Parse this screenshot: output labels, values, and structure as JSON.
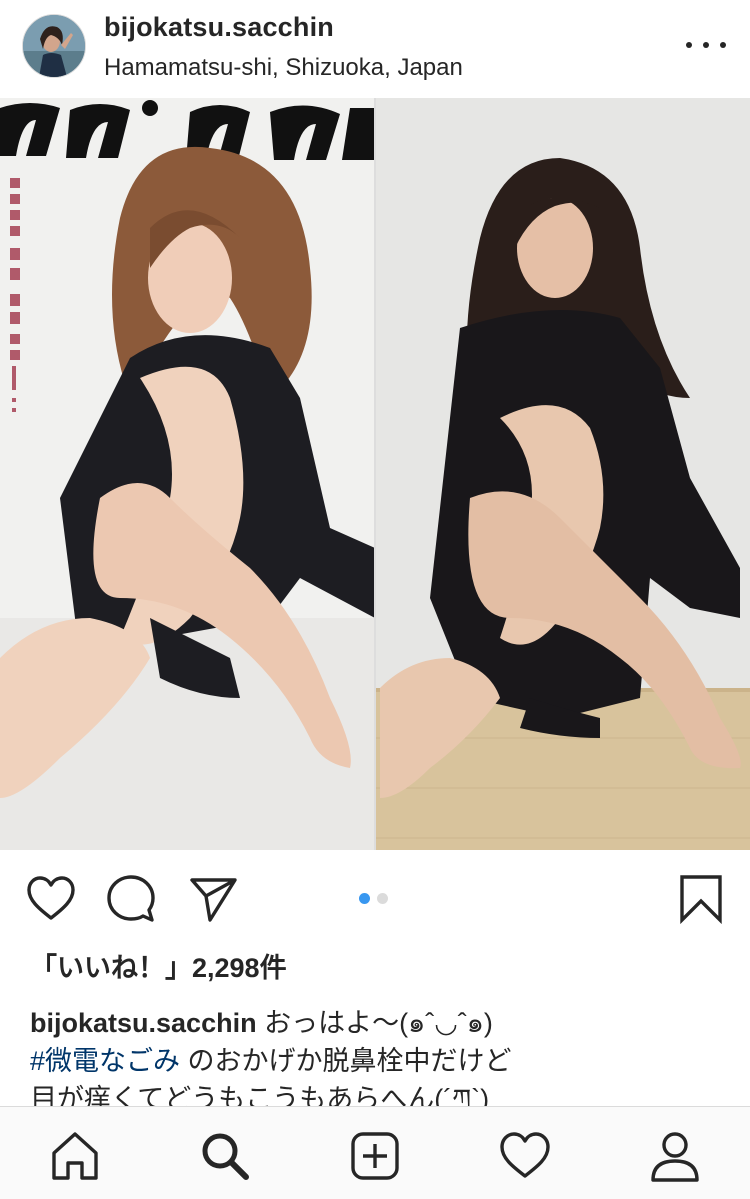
{
  "post": {
    "username": "bijokatsu.sacchin",
    "location": "Hamamatsu-shi, Shizuoka, Japan",
    "likes_text": "「いいね！」2,298件",
    "caption": {
      "username": "bijokatsu.sacchin",
      "text_line1": " おっはよ〜(๑ˆ◡ˆ๑)",
      "hashtag": "#微電なごみ",
      "text_line2": " のおかげか脱鼻栓中だけど",
      "text_line3": "目が痒くてどうもこうもあらへん(´ཀ`)"
    },
    "magazine_title_fragment": "mina",
    "magazine_vertical_text": "シルエット、質感、肌触り…。"
  },
  "carousel": {
    "active_index": 0,
    "count": 2
  },
  "icons": {
    "more": "more-options-icon",
    "like": "heart-icon",
    "comment": "comment-icon",
    "share": "send-icon",
    "save": "bookmark-icon",
    "tab_home": "home-icon",
    "tab_search": "search-icon",
    "tab_add": "add-post-icon",
    "tab_activity": "heart-icon",
    "tab_profile": "profile-icon"
  },
  "colors": {
    "text": "#262626",
    "hashtag": "#003569",
    "carousel_active": "#3897f0",
    "carousel_inactive": "#dbdbdb",
    "tabbar_bg": "#fafafa"
  }
}
